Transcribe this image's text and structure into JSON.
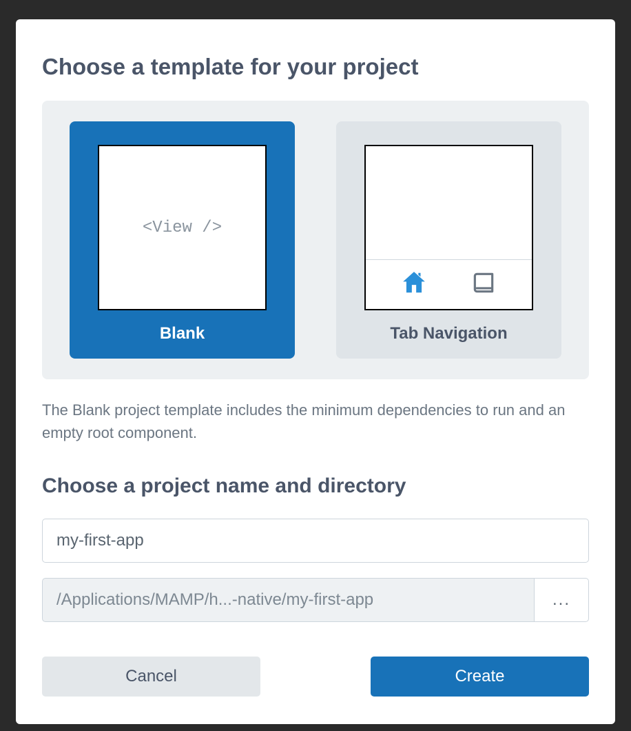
{
  "modal": {
    "template_heading": "Choose a template for your project",
    "templates": [
      {
        "label": "Blank",
        "preview_text": "<View />",
        "selected": true
      },
      {
        "label": "Tab Navigation",
        "selected": false
      }
    ],
    "description": "The Blank project template includes the minimum dependencies to run and an empty root component.",
    "name_heading": "Choose a project name and directory",
    "project_name": "my-first-app",
    "project_dir": "/Applications/MAMP/h...-native/my-first-app",
    "browse_label": "...",
    "cancel_label": "Cancel",
    "create_label": "Create"
  }
}
